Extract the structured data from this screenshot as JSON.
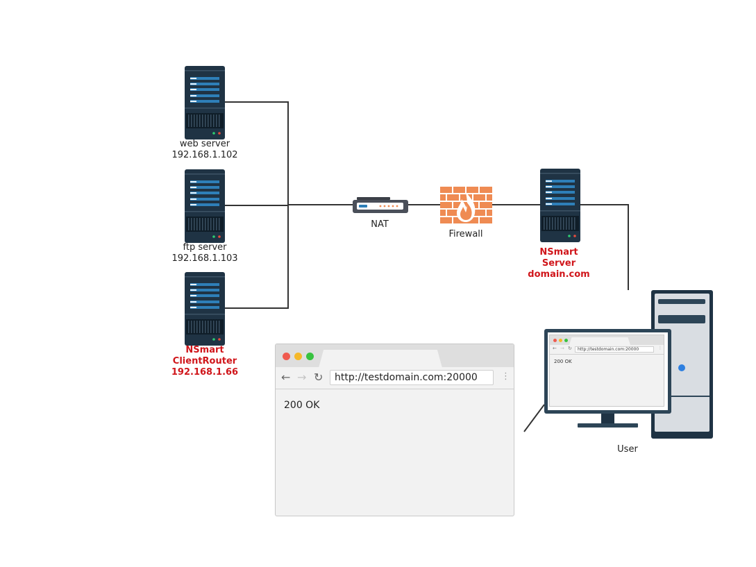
{
  "nodes": {
    "web_server": {
      "name": "web server",
      "ip": "192.168.1.102"
    },
    "ftp_server": {
      "name": "ftp server",
      "ip": "192.168.1.103"
    },
    "client_router": {
      "line1": "NSmart",
      "line2": "ClientRouter",
      "line3": "192.168.1.66"
    },
    "nat": {
      "label": "NAT"
    },
    "firewall": {
      "label": "Firewall"
    },
    "nsmart_server": {
      "line1": "NSmart",
      "line2": "Server",
      "line3": "domain.com"
    },
    "user": {
      "label": "User"
    }
  },
  "browser": {
    "url": "http://testdomain.com:20000",
    "content": "200 OK"
  },
  "colors": {
    "highlight": "#d0161b",
    "server_body": "#1f3344",
    "firewall": "#ef8b53",
    "line": "#333333"
  }
}
